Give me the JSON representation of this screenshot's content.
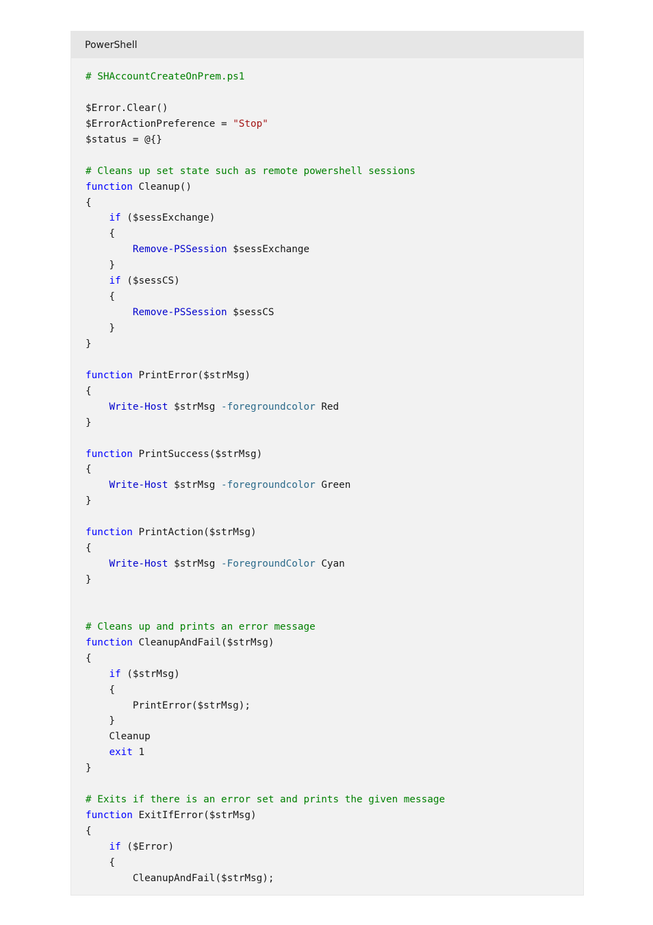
{
  "header": {
    "language_label": "PowerShell"
  },
  "colors": {
    "comment": "#008000",
    "keyword": "#0000ff",
    "cmdlet": "#0000cd",
    "parameter": "#2b6a8a",
    "string": "#a31515",
    "text": "#161616",
    "header_bg": "#e6e6e6",
    "code_bg": "#f2f2f2"
  },
  "code": {
    "lines": [
      [
        {
          "t": "comment",
          "v": "# SHAccountCreateOnPrem.ps1"
        }
      ],
      [],
      [
        {
          "t": "plain",
          "v": "$Error.Clear()"
        }
      ],
      [
        {
          "t": "plain",
          "v": "$ErrorActionPreference = "
        },
        {
          "t": "string",
          "v": "\"Stop\""
        }
      ],
      [
        {
          "t": "plain",
          "v": "$status = @{}"
        }
      ],
      [],
      [
        {
          "t": "comment",
          "v": "# Cleans up set state such as remote powershell sessions"
        }
      ],
      [
        {
          "t": "keyword",
          "v": "function"
        },
        {
          "t": "plain",
          "v": " Cleanup()"
        }
      ],
      [
        {
          "t": "plain",
          "v": "{"
        }
      ],
      [
        {
          "t": "plain",
          "v": "    "
        },
        {
          "t": "keyword",
          "v": "if"
        },
        {
          "t": "plain",
          "v": " ($sessExchange)"
        }
      ],
      [
        {
          "t": "plain",
          "v": "    {"
        }
      ],
      [
        {
          "t": "plain",
          "v": "        "
        },
        {
          "t": "cmdlet",
          "v": "Remove-PSSession"
        },
        {
          "t": "plain",
          "v": " $sessExchange"
        }
      ],
      [
        {
          "t": "plain",
          "v": "    }"
        }
      ],
      [
        {
          "t": "plain",
          "v": "    "
        },
        {
          "t": "keyword",
          "v": "if"
        },
        {
          "t": "plain",
          "v": " ($sessCS)"
        }
      ],
      [
        {
          "t": "plain",
          "v": "    {"
        }
      ],
      [
        {
          "t": "plain",
          "v": "        "
        },
        {
          "t": "cmdlet",
          "v": "Remove-PSSession"
        },
        {
          "t": "plain",
          "v": " $sessCS"
        }
      ],
      [
        {
          "t": "plain",
          "v": "    }"
        }
      ],
      [
        {
          "t": "plain",
          "v": "}"
        }
      ],
      [],
      [
        {
          "t": "keyword",
          "v": "function"
        },
        {
          "t": "plain",
          "v": " PrintError($strMsg)"
        }
      ],
      [
        {
          "t": "plain",
          "v": "{"
        }
      ],
      [
        {
          "t": "plain",
          "v": "    "
        },
        {
          "t": "cmdlet",
          "v": "Write-Host"
        },
        {
          "t": "plain",
          "v": " $strMsg "
        },
        {
          "t": "param",
          "v": "-foregroundcolor"
        },
        {
          "t": "plain",
          "v": " Red"
        }
      ],
      [
        {
          "t": "plain",
          "v": "}"
        }
      ],
      [],
      [
        {
          "t": "keyword",
          "v": "function"
        },
        {
          "t": "plain",
          "v": " PrintSuccess($strMsg)"
        }
      ],
      [
        {
          "t": "plain",
          "v": "{"
        }
      ],
      [
        {
          "t": "plain",
          "v": "    "
        },
        {
          "t": "cmdlet",
          "v": "Write-Host"
        },
        {
          "t": "plain",
          "v": " $strMsg "
        },
        {
          "t": "param",
          "v": "-foregroundcolor"
        },
        {
          "t": "plain",
          "v": " Green"
        }
      ],
      [
        {
          "t": "plain",
          "v": "}"
        }
      ],
      [],
      [
        {
          "t": "keyword",
          "v": "function"
        },
        {
          "t": "plain",
          "v": " PrintAction($strMsg)"
        }
      ],
      [
        {
          "t": "plain",
          "v": "{"
        }
      ],
      [
        {
          "t": "plain",
          "v": "    "
        },
        {
          "t": "cmdlet",
          "v": "Write-Host"
        },
        {
          "t": "plain",
          "v": " $strMsg "
        },
        {
          "t": "param",
          "v": "-ForegroundColor"
        },
        {
          "t": "plain",
          "v": " Cyan"
        }
      ],
      [
        {
          "t": "plain",
          "v": "}"
        }
      ],
      [],
      [],
      [
        {
          "t": "comment",
          "v": "# Cleans up and prints an error message"
        }
      ],
      [
        {
          "t": "keyword",
          "v": "function"
        },
        {
          "t": "plain",
          "v": " CleanupAndFail($strMsg)"
        }
      ],
      [
        {
          "t": "plain",
          "v": "{"
        }
      ],
      [
        {
          "t": "plain",
          "v": "    "
        },
        {
          "t": "keyword",
          "v": "if"
        },
        {
          "t": "plain",
          "v": " ($strMsg)"
        }
      ],
      [
        {
          "t": "plain",
          "v": "    {"
        }
      ],
      [
        {
          "t": "plain",
          "v": "        PrintError($strMsg);"
        }
      ],
      [
        {
          "t": "plain",
          "v": "    }"
        }
      ],
      [
        {
          "t": "plain",
          "v": "    Cleanup"
        }
      ],
      [
        {
          "t": "plain",
          "v": "    "
        },
        {
          "t": "keyword",
          "v": "exit"
        },
        {
          "t": "plain",
          "v": " 1"
        }
      ],
      [
        {
          "t": "plain",
          "v": "}"
        }
      ],
      [],
      [
        {
          "t": "comment",
          "v": "# Exits if there is an error set and prints the given message"
        }
      ],
      [
        {
          "t": "keyword",
          "v": "function"
        },
        {
          "t": "plain",
          "v": " ExitIfError($strMsg)"
        }
      ],
      [
        {
          "t": "plain",
          "v": "{"
        }
      ],
      [
        {
          "t": "plain",
          "v": "    "
        },
        {
          "t": "keyword",
          "v": "if"
        },
        {
          "t": "plain",
          "v": " ($Error)"
        }
      ],
      [
        {
          "t": "plain",
          "v": "    {"
        }
      ],
      [
        {
          "t": "plain",
          "v": "        CleanupAndFail($strMsg);"
        }
      ]
    ]
  }
}
